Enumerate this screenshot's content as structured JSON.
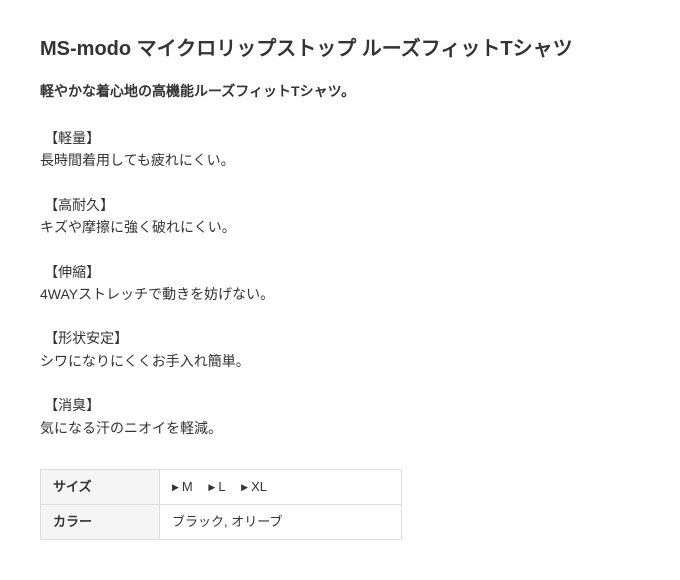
{
  "product": {
    "title": "MS-modo マイクロリップストップ ルーズフィットTシャツ",
    "subtitle": "軽やかな着心地の高機能ルーズフィットTシャツ。"
  },
  "features": [
    {
      "label": "【軽量】",
      "desc": "長時間着用しても疲れにくい。"
    },
    {
      "label": "【高耐久】",
      "desc": "キズや摩擦に強く破れにくい。"
    },
    {
      "label": "【伸縮】",
      "desc": "4WAYストレッチで動きを妨げない。"
    },
    {
      "label": "【形状安定】",
      "desc": "シワになりにくくお手入れ簡単。"
    },
    {
      "label": "【消臭】",
      "desc": "気になる汗のニオイを軽減。"
    }
  ],
  "spec": {
    "size_label": "サイズ",
    "sizes": [
      "M",
      "L",
      "XL"
    ],
    "color_label": "カラー",
    "colors": "ブラック, オリーブ"
  }
}
